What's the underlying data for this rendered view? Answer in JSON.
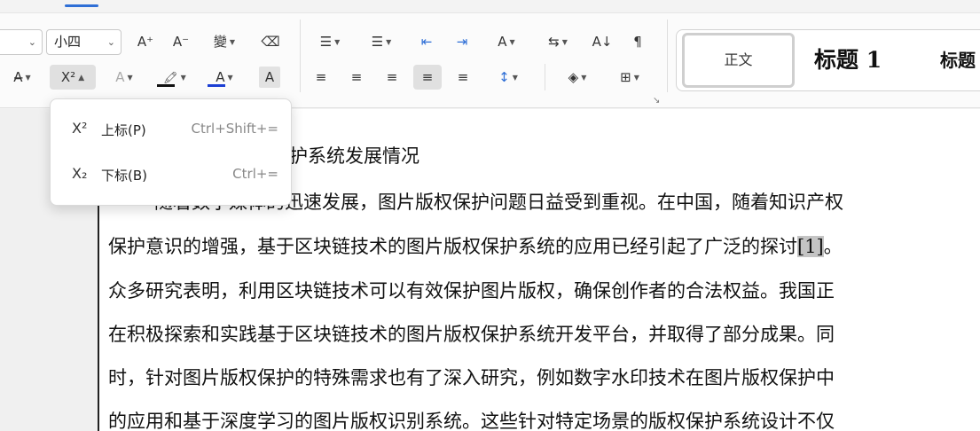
{
  "ribbon": {
    "font_size": {
      "value": "小四"
    },
    "font_group_icons": {
      "grow": "A⁺",
      "shrink": "A⁻",
      "phonetic": "變",
      "clear": "⌫",
      "strike": "A̶",
      "superscript": "X²",
      "effects": "A",
      "highlight": "🖍",
      "font_color": "A",
      "char_shade": "A"
    },
    "paragraph_icons": {
      "bullets": "☰",
      "numbering": "☰",
      "outdent": "⇤",
      "indent": "⇥",
      "asian_layout": "A",
      "text_direction": "⇆",
      "sort": "A↓",
      "show_marks": "¶",
      "align_left": "≡",
      "center": "≡",
      "align_right": "≡",
      "justify": "≡",
      "distributed": "≡",
      "line_spacing": "↕",
      "shading": "◈",
      "borders": "⊞"
    },
    "styles": {
      "normal": "正文",
      "heading1": "标题 1",
      "heading2": "标题"
    }
  },
  "popup": {
    "items": [
      {
        "icon": "X²",
        "label": "上标(P)",
        "shortcut": "Ctrl+Shift+="
      },
      {
        "icon": "X₂",
        "label": "下标(B)",
        "shortcut": "Ctrl+="
      }
    ]
  },
  "document": {
    "heading_fragment": "护系统发展情况",
    "line1": "随着数字媒体的迅速发展，图片版权保护问题日益受到重视。在中国，随着知识产权",
    "line2_before": "保护意识的增强，基于区块链技术的图片版权保护系统的应用已经引起了广泛的探讨",
    "line2_cite": "[1]",
    "line2_after": "。",
    "line3": "众多研究表明，利用区块链技术可以有效保护图片版权，确保创作者的合法权益。我国正",
    "line4": "在积极探索和实践基于区块链技术的图片版权保护系统开发平台，并取得了部分成果。同",
    "line5": "时，针对图片版权保护的特殊需求也有了深入研究，例如数字水印技术在图片版权保护中",
    "line6": "的应用和基于深度学习的图片版权识别系统。这些针对特定场景的版权保护系统设计不仅"
  },
  "colors": {
    "accent": "#2f6fd6",
    "font_color_bar": "#1c3fd4",
    "highlight_bar": "#111111",
    "citation_shading": "#c4c4c4"
  }
}
